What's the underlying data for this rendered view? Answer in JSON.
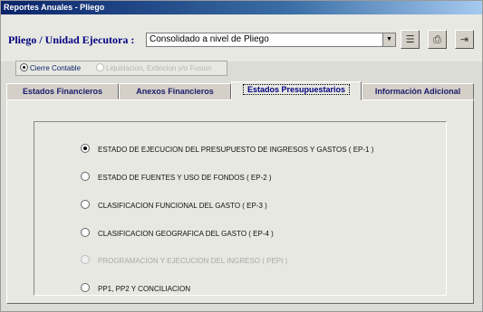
{
  "window": {
    "title": "Reportes Anuales - Pliego"
  },
  "header": {
    "pliego_label": "Pliego / Unidad Ejecutora :",
    "pliego_value": "Consolidado a nivel de Pliego"
  },
  "toolbar": {
    "icons": [
      "list-icon",
      "printer-icon",
      "exit-icon"
    ]
  },
  "mode": {
    "options": [
      {
        "label": "Cierre Contable",
        "selected": true,
        "enabled": true
      },
      {
        "label": "Liquidacion, Extincion y/o Fusion",
        "selected": false,
        "enabled": false
      }
    ]
  },
  "tabs": [
    {
      "label": "Estados Financieros",
      "active": false
    },
    {
      "label": "Anexos Financieros",
      "active": false
    },
    {
      "label": "Estados Presupuestarios",
      "active": true
    },
    {
      "label": "Información Adicional",
      "active": false
    }
  ],
  "report_options": [
    {
      "label": "ESTADO DE EJECUCION DEL PRESUPUESTO DE INGRESOS Y GASTOS ( EP-1 )",
      "selected": true,
      "enabled": true
    },
    {
      "label": "ESTADO DE FUENTES Y USO DE FONDOS ( EP-2 )",
      "selected": false,
      "enabled": true
    },
    {
      "label": "CLASIFICACION FUNCIONAL DEL GASTO ( EP-3 )",
      "selected": false,
      "enabled": true
    },
    {
      "label": "CLASIFICACION GEOGRAFICA DEL GASTO ( EP-4 )",
      "selected": false,
      "enabled": true
    },
    {
      "label": "PROGRAMACION Y EJECUCION DEL INGRESO ( PEPI )",
      "selected": false,
      "enabled": false
    },
    {
      "label": "PP1, PP2 Y CONCILIACION",
      "selected": false,
      "enabled": true
    }
  ]
}
